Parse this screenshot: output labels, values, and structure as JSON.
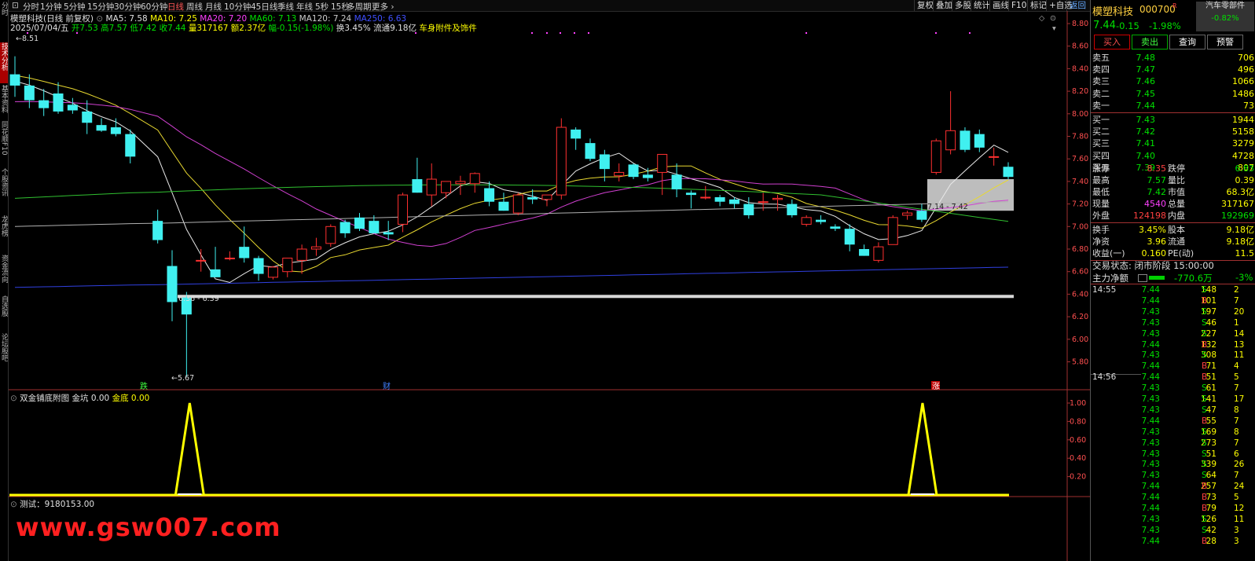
{
  "left_tabs": [
    "分时",
    "技术分析",
    "基本资料",
    "同花顺F10",
    "个股资讯",
    "龙虎榜",
    "资金流向",
    "自选股",
    "论坛股吧"
  ],
  "left_tabs_active": 1,
  "toolbar": {
    "periods": [
      "分时",
      "1分钟",
      "5分钟",
      "15分钟",
      "30分钟",
      "60分钟",
      "日线",
      "周线",
      "月线",
      "10分钟",
      "45日线",
      "季线",
      "年线",
      "5秒",
      "15秒",
      "多周期",
      "更多"
    ],
    "selected_period": "日线",
    "right_buttons": [
      "复权",
      "叠加",
      "多股",
      "统计",
      "画线",
      "F10",
      "标记",
      "+自选",
      "返回"
    ]
  },
  "header": {
    "line1": {
      "name": "模塑科技(日线 前复权)",
      "ma5": "MA5: 7.58",
      "ma10": "MA10: 7.25",
      "ma20": "MA20: 7.20",
      "ma60": "MA60: 7.13",
      "ma120": "MA120: 7.24",
      "ma250": "MA250: 6.63"
    },
    "line2": {
      "date": "2025/07/04/五",
      "open": "开7.53",
      "high": "高7.57",
      "low": "低7.42",
      "close": "收7.44",
      "volume": "量317167",
      "amount": "额2.37亿",
      "change": "幅-0.15(-1.98%)",
      "turnover": "换3.45%",
      "float": "流通9.18亿",
      "sector": "车身附件及饰件"
    }
  },
  "chart_data": [
    {
      "type": "candlestick",
      "title": "模塑科技(日线 前复权)",
      "y_range": [
        5.6,
        8.9
      ],
      "y_ticks": [
        "8.80",
        "8.60",
        "8.40",
        "8.20",
        "8.00",
        "7.80",
        "7.60",
        "7.40",
        "7.20",
        "7.00",
        "6.80",
        "6.60",
        "6.40",
        "6.20",
        "6.00",
        "5.80"
      ],
      "candles_ohlc": [
        [
          8.35,
          8.51,
          8.15,
          8.25
        ],
        [
          8.25,
          8.35,
          8.05,
          8.12
        ],
        [
          8.12,
          8.22,
          7.98,
          8.05
        ],
        [
          8.18,
          8.28,
          8.0,
          8.02
        ],
        [
          8.08,
          8.14,
          8.0,
          8.03
        ],
        [
          8.02,
          8.12,
          7.82,
          7.92
        ],
        [
          7.9,
          7.96,
          7.84,
          7.85
        ],
        [
          7.88,
          7.96,
          7.8,
          7.82
        ],
        [
          7.82,
          7.86,
          7.56,
          7.62
        ],
        [
          7.05,
          7.15,
          6.85,
          6.88
        ],
        [
          6.65,
          6.79,
          6.16,
          6.33
        ],
        [
          6.37,
          6.42,
          5.67,
          6.22
        ],
        [
          6.7,
          6.8,
          6.6,
          6.7
        ],
        [
          6.62,
          6.82,
          6.55,
          6.55
        ],
        [
          6.72,
          6.78,
          6.7,
          6.72
        ],
        [
          6.82,
          7.0,
          6.68,
          6.72
        ],
        [
          6.72,
          6.74,
          6.52,
          6.58
        ],
        [
          6.55,
          6.65,
          6.53,
          6.64
        ],
        [
          6.6,
          6.72,
          6.55,
          6.72
        ],
        [
          6.7,
          6.84,
          6.58,
          6.8
        ],
        [
          6.8,
          6.9,
          6.74,
          6.82
        ],
        [
          6.85,
          7.02,
          6.82,
          7.0
        ],
        [
          7.04,
          7.06,
          6.9,
          6.94
        ],
        [
          7.08,
          7.12,
          6.96,
          6.98
        ],
        [
          7.05,
          7.1,
          6.96,
          6.94
        ],
        [
          6.95,
          7.05,
          6.88,
          6.93
        ],
        [
          7.02,
          7.3,
          6.95,
          7.28
        ],
        [
          7.42,
          7.61,
          7.3,
          7.3
        ],
        [
          7.28,
          7.56,
          7.18,
          7.42
        ],
        [
          7.3,
          7.39,
          7.25,
          7.4
        ],
        [
          7.38,
          7.45,
          7.28,
          7.4
        ],
        [
          7.38,
          7.48,
          7.3,
          7.47
        ],
        [
          7.34,
          7.4,
          7.18,
          7.22
        ],
        [
          7.22,
          7.3,
          7.14,
          7.14
        ],
        [
          7.12,
          7.3,
          7.1,
          7.28
        ],
        [
          7.26,
          7.33,
          7.2,
          7.24
        ],
        [
          7.24,
          7.28,
          7.18,
          7.28
        ],
        [
          7.28,
          7.96,
          7.24,
          7.88
        ],
        [
          7.86,
          7.88,
          7.68,
          7.78
        ],
        [
          7.74,
          7.78,
          7.58,
          7.6
        ],
        [
          7.64,
          7.68,
          7.4,
          7.51
        ],
        [
          7.45,
          7.56,
          7.4,
          7.48
        ],
        [
          7.55,
          7.56,
          7.42,
          7.44
        ],
        [
          7.46,
          7.52,
          7.4,
          7.43
        ],
        [
          7.48,
          7.64,
          7.28,
          7.64
        ],
        [
          7.46,
          7.56,
          7.26,
          7.33
        ],
        [
          7.3,
          7.32,
          7.16,
          7.28
        ],
        [
          7.26,
          7.36,
          7.24,
          7.26
        ],
        [
          7.26,
          7.28,
          7.18,
          7.22
        ],
        [
          7.24,
          7.26,
          7.16,
          7.2
        ],
        [
          7.2,
          7.26,
          7.07,
          7.1
        ],
        [
          7.22,
          7.3,
          7.14,
          7.22
        ],
        [
          7.24,
          7.28,
          7.14,
          7.25
        ],
        [
          7.2,
          7.24,
          7.08,
          7.1
        ],
        [
          7.02,
          7.1,
          7.0,
          7.08
        ],
        [
          7.06,
          7.1,
          7.02,
          7.04
        ],
        [
          7.0,
          7.02,
          6.96,
          6.98
        ],
        [
          6.98,
          7.02,
          6.78,
          6.84
        ],
        [
          6.8,
          6.84,
          6.74,
          6.74
        ],
        [
          6.7,
          6.86,
          6.68,
          6.82
        ],
        [
          6.84,
          7.1,
          6.84,
          7.08
        ],
        [
          7.1,
          7.14,
          7.06,
          7.12
        ],
        [
          7.14,
          7.2,
          7.04,
          7.06
        ],
        [
          7.48,
          7.78,
          7.46,
          7.76
        ],
        [
          7.68,
          8.2,
          7.64,
          7.85
        ],
        [
          7.85,
          7.88,
          7.66,
          7.68
        ],
        [
          7.82,
          7.86,
          7.66,
          7.7
        ],
        [
          7.62,
          7.7,
          7.54,
          7.62
        ],
        [
          7.53,
          7.57,
          7.42,
          7.44
        ]
      ],
      "series": [
        {
          "name": "MA5",
          "color": "#e8e8e8"
        },
        {
          "name": "MA10",
          "color": "#e8d830"
        },
        {
          "name": "MA20",
          "color": "#d040d0"
        },
        {
          "name": "MA60",
          "color": "#30c030"
        },
        {
          "name": "MA120",
          "color": "#b0b0b0"
        },
        {
          "name": "MA250",
          "color": "#3040e0"
        }
      ],
      "annotations": [
        "8.51",
        "5.67",
        "6.36 - 6.39",
        "7.14 - 7.42",
        "跌",
        "财",
        "涨"
      ],
      "hline": 6.38,
      "box": [
        7.14,
        7.42
      ]
    },
    {
      "type": "line",
      "title": "双金铺底附图",
      "y_ticks": [
        "1.00",
        "0.80",
        "0.60",
        "0.40",
        "0.20"
      ],
      "y_range": [
        0,
        1.0
      ],
      "series": [
        {
          "name": "金坑",
          "color": "#ffffff",
          "value_text": "0.00"
        },
        {
          "name": "金底",
          "color": "#ffff00",
          "value_text": "0.00"
        }
      ],
      "peaks_at_index": [
        11,
        62
      ]
    }
  ],
  "sub_indicator_label": "测试：9180153.00",
  "watermark": "www.gsw007.com",
  "panel": {
    "name": "模塑科技",
    "code": "000700",
    "badge": "R",
    "sector": "汽车零部件",
    "sector_change": "-0.82%",
    "price": "7.44",
    "change": "-0.15",
    "change_pct": "-1.98%",
    "buttons": [
      "买入",
      "卖出",
      "查询",
      "预警"
    ],
    "asks": [
      {
        "label": "卖五",
        "price": "7.48",
        "vol": "706"
      },
      {
        "label": "卖四",
        "price": "7.47",
        "vol": "496"
      },
      {
        "label": "卖三",
        "price": "7.46",
        "vol": "1066"
      },
      {
        "label": "卖二",
        "price": "7.45",
        "vol": "1486"
      },
      {
        "label": "卖一",
        "price": "7.44",
        "vol": "73"
      }
    ],
    "bids": [
      {
        "label": "买一",
        "price": "7.43",
        "vol": "1944"
      },
      {
        "label": "买二",
        "price": "7.42",
        "vol": "5158"
      },
      {
        "label": "买三",
        "price": "7.41",
        "vol": "3279"
      },
      {
        "label": "买四",
        "price": "7.40",
        "vol": "4728"
      },
      {
        "label": "买五",
        "price": "7.39",
        "vol": "807"
      }
    ],
    "stats": [
      {
        "l1": "涨停",
        "v1": "8.35",
        "l2": "跌停",
        "v2": "6.83"
      },
      {
        "l1": "最高",
        "v1": "7.57",
        "l2": "量比",
        "v2": "0.39"
      },
      {
        "l1": "最低",
        "v1": "7.42",
        "l2": "市值",
        "v2": "68.3亿"
      },
      {
        "l1": "现量",
        "v1": "4540",
        "l2": "总量",
        "v2": "317167"
      },
      {
        "l1": "外盘",
        "v1": "124198",
        "l2": "内盘",
        "v2": "192969"
      },
      {
        "l1": "换手",
        "v1": "3.45%",
        "l2": "股本",
        "v2": "9.18亿"
      },
      {
        "l1": "净资",
        "v1": "3.96",
        "l2": "流通",
        "v2": "9.18亿"
      },
      {
        "l1": "收益(一)",
        "v1": "0.160",
        "l2": "PE(动)",
        "v2": "11.5"
      }
    ],
    "status": "交易状态: 闭市阶段 15:00:00",
    "main_flow_label": "主力净额",
    "main_flow_value": "-770.6万",
    "main_flow_pct": "-3%",
    "ticks": [
      {
        "t": "14:55",
        "p": "7.44",
        "v": "148",
        "d": "S",
        "n": "2"
      },
      {
        "t": "",
        "p": "7.44",
        "v": "101",
        "d": "B",
        "n": "7"
      },
      {
        "t": "",
        "p": "7.43",
        "v": "197",
        "d": "S",
        "n": "20"
      },
      {
        "t": "",
        "p": "7.43",
        "v": "46",
        "d": "S",
        "n": "1"
      },
      {
        "t": "",
        "p": "7.43",
        "v": "227",
        "d": "S",
        "n": "14"
      },
      {
        "t": "",
        "p": "7.44",
        "v": "132",
        "d": "B",
        "n": "13"
      },
      {
        "t": "",
        "p": "7.43",
        "v": "308",
        "d": "S",
        "n": "11"
      },
      {
        "t": "",
        "p": "7.44",
        "v": "71",
        "d": "B",
        "n": "4"
      },
      {
        "t": "14:56",
        "p": "7.44",
        "v": "51",
        "d": "B",
        "n": "5"
      },
      {
        "t": "",
        "p": "7.43",
        "v": "61",
        "d": "S",
        "n": "7"
      },
      {
        "t": "",
        "p": "7.43",
        "v": "141",
        "d": "S",
        "n": "17"
      },
      {
        "t": "",
        "p": "7.43",
        "v": "47",
        "d": "S",
        "n": "8"
      },
      {
        "t": "",
        "p": "7.44",
        "v": "55",
        "d": "B",
        "n": "7"
      },
      {
        "t": "",
        "p": "7.43",
        "v": "169",
        "d": "S",
        "n": "8"
      },
      {
        "t": "",
        "p": "7.43",
        "v": "273",
        "d": "S",
        "n": "7"
      },
      {
        "t": "",
        "p": "7.43",
        "v": "51",
        "d": "S",
        "n": "6"
      },
      {
        "t": "",
        "p": "7.43",
        "v": "339",
        "d": "S",
        "n": "26"
      },
      {
        "t": "",
        "p": "7.43",
        "v": "64",
        "d": "S",
        "n": "7"
      },
      {
        "t": "",
        "p": "7.44",
        "v": "257",
        "d": "B",
        "n": "24"
      },
      {
        "t": "",
        "p": "7.44",
        "v": "73",
        "d": "B",
        "n": "5"
      },
      {
        "t": "",
        "p": "7.44",
        "v": "79",
        "d": "B",
        "n": "12"
      },
      {
        "t": "",
        "p": "7.43",
        "v": "126",
        "d": "S",
        "n": "11"
      },
      {
        "t": "",
        "p": "7.43",
        "v": "42",
        "d": "S",
        "n": "3"
      },
      {
        "t": "",
        "p": "7.44",
        "v": "28",
        "d": "B",
        "n": "3"
      }
    ]
  }
}
